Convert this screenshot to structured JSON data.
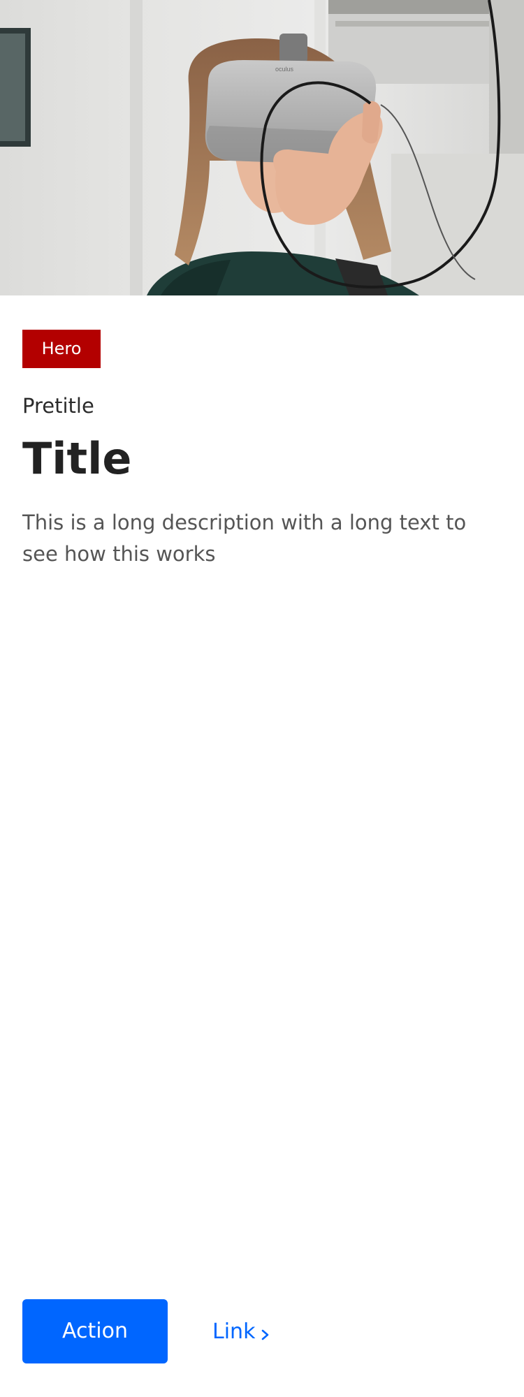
{
  "hero": {
    "tag_label": "Hero",
    "pretitle": "Pretitle",
    "title": "Title",
    "description": "This is a long description with a long text to see how this works",
    "headset_brand": "oculus"
  },
  "actions": {
    "primary_label": "Action",
    "link_label": "Link"
  },
  "colors": {
    "tag_background": "#b30000",
    "primary": "#0066ff",
    "title_text": "#222222",
    "description_text": "#555555"
  }
}
